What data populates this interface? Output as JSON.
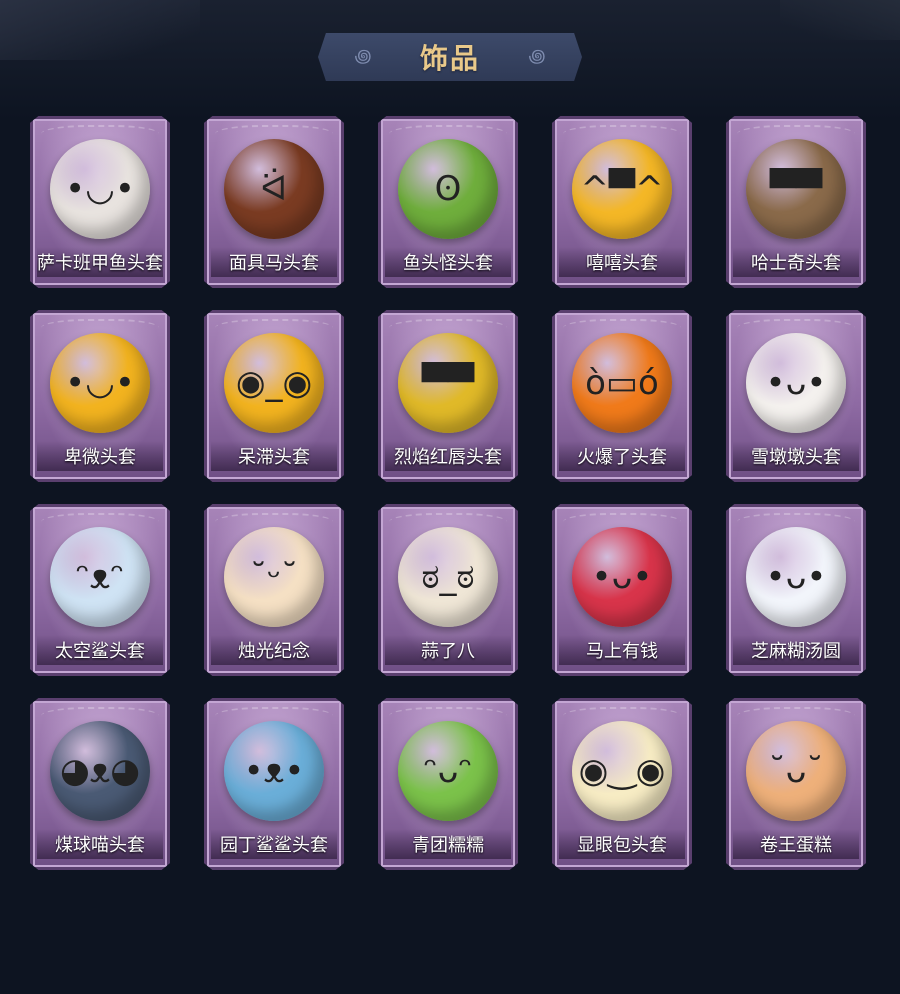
{
  "header": {
    "title": "饰品",
    "ornament_left": "꩜",
    "ornament_right": "꩜"
  },
  "items": [
    {
      "label": "萨卡班甲鱼头套",
      "icon": "fish-head-icon",
      "color": "#e8e3df",
      "glyph": "•◡•"
    },
    {
      "label": "面具马头套",
      "icon": "horse-head-icon",
      "color": "#7a3b22",
      "glyph": "ᐛ"
    },
    {
      "label": "鱼头怪头套",
      "icon": "fish-monster-icon",
      "color": "#6fae3c",
      "glyph": "ʘ"
    },
    {
      "label": "嘻嘻头套",
      "icon": "grin-emoji-icon",
      "color": "#f4b726",
      "glyph": "^▀^"
    },
    {
      "label": "哈士奇头套",
      "icon": "husky-head-icon",
      "color": "#8a6a4a",
      "glyph": "▀▀"
    },
    {
      "label": "卑微头套",
      "icon": "humble-emoji-icon",
      "color": "#f2b31f",
      "glyph": "•◡•"
    },
    {
      "label": "呆滞头套",
      "icon": "dazed-emoji-icon",
      "color": "#f2b31f",
      "glyph": "◉_◉"
    },
    {
      "label": "烈焰红唇头套",
      "icon": "pikachu-lips-icon",
      "color": "#e0b928",
      "glyph": "▀▀"
    },
    {
      "label": "火爆了头套",
      "icon": "fire-head-icon",
      "color": "#f07a1a",
      "glyph": "ò▭ó"
    },
    {
      "label": "雪墩墩头套",
      "icon": "snowman-head-icon",
      "color": "#f4f1ee",
      "glyph": "•ᴗ•"
    },
    {
      "label": "太空鲨头套",
      "icon": "space-shark-icon",
      "color": "#cfe3f4",
      "glyph": "ᵔᴥᵔ"
    },
    {
      "label": "烛光纪念",
      "icon": "candle-head-icon",
      "color": "#f5e0c4",
      "glyph": "˘ᵕ˘"
    },
    {
      "label": "蒜了八",
      "icon": "garlic-head-icon",
      "color": "#efe6d6",
      "glyph": "ಠ_ಠ"
    },
    {
      "label": "马上有钱",
      "icon": "pony-head-icon",
      "color": "#d8344a",
      "glyph": "•ᴗ•"
    },
    {
      "label": "芝麻糊汤圆",
      "icon": "tangyuan-head-icon",
      "color": "#f2f5fb",
      "glyph": "•ᴗ•"
    },
    {
      "label": "煤球喵头套",
      "icon": "black-cat-head-icon",
      "color": "#4a5a74",
      "glyph": "◕ᴥ◕"
    },
    {
      "label": "园丁鲨鲨头套",
      "icon": "gardener-shark-icon",
      "color": "#6aaed8",
      "glyph": "•ᴥ•"
    },
    {
      "label": "青团糯糯",
      "icon": "green-dumpling-icon",
      "color": "#7bc24a",
      "glyph": "ᵔᴗᵔ"
    },
    {
      "label": "显眼包头套",
      "icon": "lightbulb-head-icon",
      "color": "#f7ecc4",
      "glyph": "◉‿◉"
    },
    {
      "label": "卷王蛋糕",
      "icon": "cake-roll-icon",
      "color": "#eeb07a",
      "glyph": "˘ᴗ˘"
    }
  ]
}
